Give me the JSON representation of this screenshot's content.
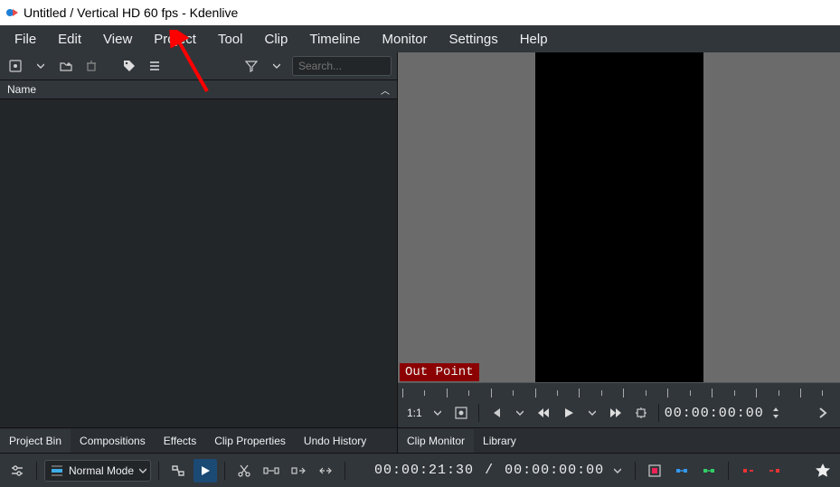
{
  "title": "Untitled / Vertical HD 60 fps - Kdenlive",
  "menubar": {
    "file": "File",
    "edit": "Edit",
    "view": "View",
    "project": "Project",
    "tool": "Tool",
    "clip": "Clip",
    "timeline": "Timeline",
    "monitor": "Monitor",
    "settings": "Settings",
    "help": "Help"
  },
  "bin_toolbar": {
    "search_placeholder": "Search..."
  },
  "bin_header": {
    "name": "Name"
  },
  "tabs_left": {
    "project_bin": "Project Bin",
    "compositions": "Compositions",
    "effects": "Effects",
    "clip_properties": "Clip Properties",
    "undo_history": "Undo History"
  },
  "tabs_right": {
    "clip_monitor": "Clip Monitor",
    "library": "Library"
  },
  "monitor": {
    "out_point": "Out Point",
    "scale": "1:1",
    "timecode": "00:00:00:00"
  },
  "toolbar": {
    "mode_label": "Normal Mode",
    "timecode_now": "00:00:21:30",
    "separator": "/",
    "timecode_total": "00:00:00:00"
  }
}
